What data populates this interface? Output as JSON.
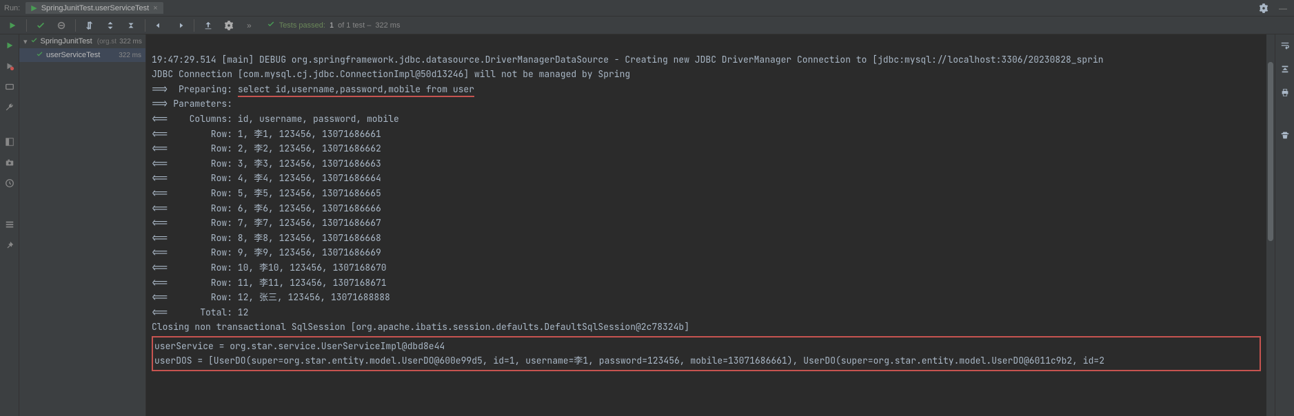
{
  "run_label": "Run:",
  "tab": {
    "title": "SpringJunitTest.userServiceTest",
    "icon": "play"
  },
  "tests_status": {
    "prefix": "Tests passed:",
    "count": "1",
    "middle": "of 1 test –",
    "duration": "322 ms"
  },
  "tree": {
    "root": {
      "label": "SpringJunitTest",
      "pkg": "(org.st",
      "time": "322 ms"
    },
    "child": {
      "label": "userServiceTest",
      "time": "322 ms"
    }
  },
  "console": {
    "line1_pre": "19:47:29.514 [main] DEBUG org.springframework.jdbc.datasource.DriverManagerDataSource - Creating new JDBC DriverManager Connection to [jdbc:mysql://localhost:3306/20230828_sprin",
    "line2": "JDBC Connection [com.mysql.cj.jdbc.ConnectionImpl@50d13246] will not be managed by Spring",
    "line3_prefix": "==>  Preparing: ",
    "line3_sql": "select id,username,password,mobile from user",
    "line4": "==> Parameters: ",
    "line5": "<==    Columns: id, username, password, mobile",
    "rows": [
      "<==        Row: 1, 李1, 123456, 13071686661",
      "<==        Row: 2, 李2, 123456, 13071686662",
      "<==        Row: 3, 李3, 123456, 13071686663",
      "<==        Row: 4, 李4, 123456, 13071686664",
      "<==        Row: 5, 李5, 123456, 13071686665",
      "<==        Row: 6, 李6, 123456, 13071686666",
      "<==        Row: 7, 李7, 123456, 13071686667",
      "<==        Row: 8, 李8, 123456, 13071686668",
      "<==        Row: 9, 李9, 123456, 13071686669",
      "<==        Row: 10, 李10, 123456, 1307168670",
      "<==        Row: 11, 李11, 123456, 1307168671",
      "<==        Row: 12, 张三, 123456, 13071688888"
    ],
    "total": "<==      Total: 12",
    "closing": "Closing non transactional SqlSession [org.apache.ibatis.session.defaults.DefaultSqlSession@2c78324b]",
    "boxed1": "userService = org.star.service.UserServiceImpl@dbd8e44",
    "boxed2": "userDOS = [UserDO(super=org.star.entity.model.UserDO@600e99d5, id=1, username=李1, password=123456, mobile=13071686661), UserDO(super=org.star.entity.model.UserDO@6011c9b2, id=2"
  }
}
